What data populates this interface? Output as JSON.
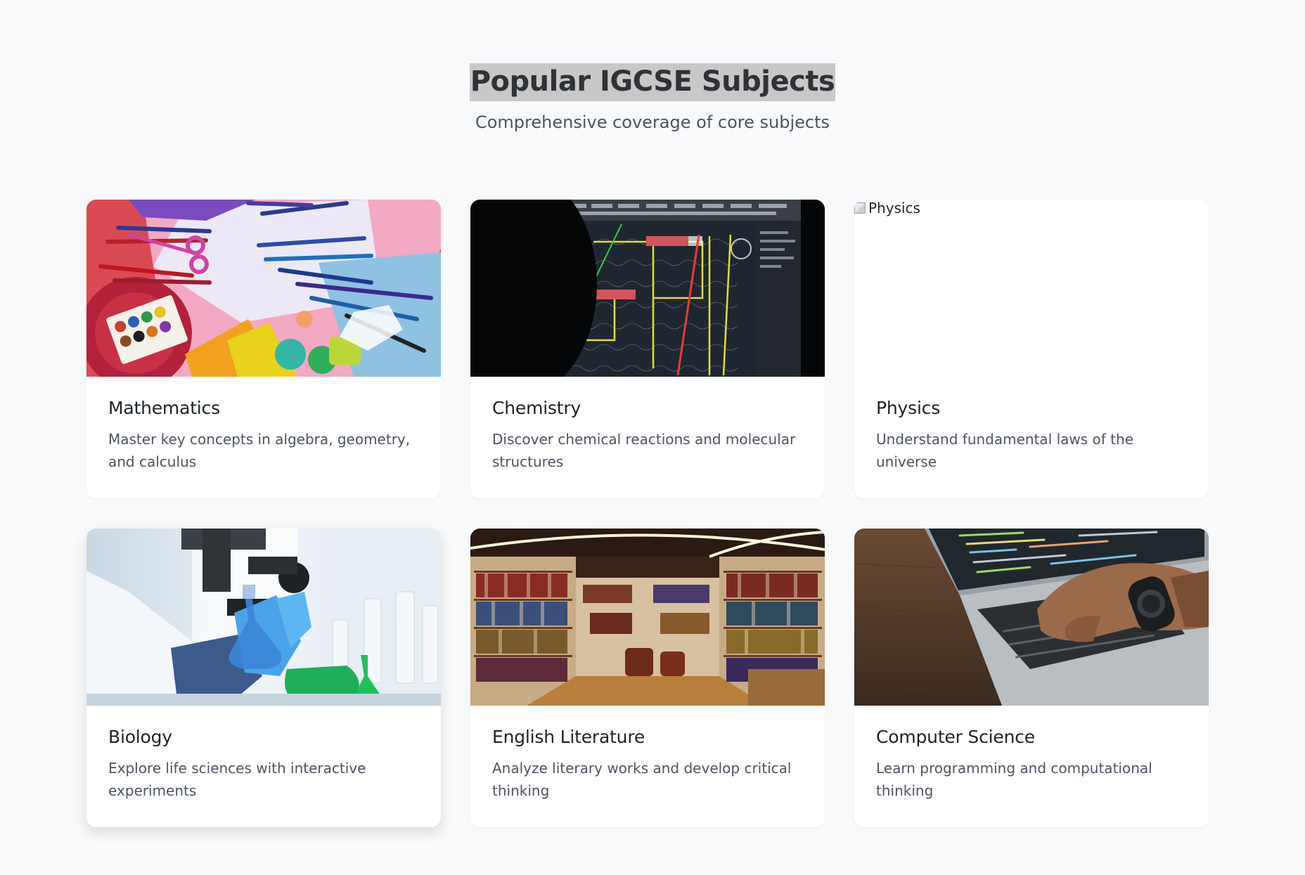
{
  "header": {
    "title": "Popular IGCSE Subjects",
    "subtitle": "Comprehensive coverage of core subjects"
  },
  "subjects": [
    {
      "title": "Mathematics",
      "description": "Master key concepts in algebra, geometry, and calculus",
      "image_alt": "Mathematics"
    },
    {
      "title": "Chemistry",
      "description": "Discover chemical reactions and molecular structures",
      "image_alt": "Chemistry"
    },
    {
      "title": "Physics",
      "description": "Understand fundamental laws of the universe",
      "image_alt": "Physics",
      "image_broken": true
    },
    {
      "title": "Biology",
      "description": "Explore life sciences with interactive experiments",
      "image_alt": "Biology"
    },
    {
      "title": "English Literature",
      "description": "Analyze literary works and develop critical thinking",
      "image_alt": "English Literature"
    },
    {
      "title": "Computer Science",
      "description": "Learn programming and computational thinking",
      "image_alt": "Computer Science"
    }
  ],
  "colors": {
    "page_background": "#f8f9fb",
    "card_background": "#ffffff",
    "title_highlight": "#c8c8c8"
  }
}
